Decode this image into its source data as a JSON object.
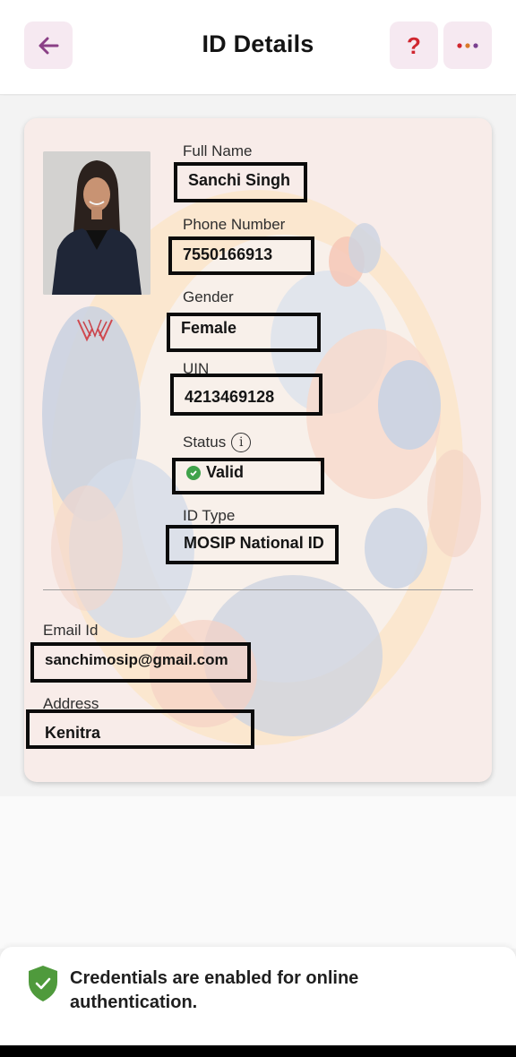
{
  "header": {
    "title": "ID Details",
    "back_icon": "arrow-left-icon",
    "help_label": "?",
    "more_icon": "ellipsis-icon",
    "button_bg": "#f6e9f1",
    "accent": "#8a3f86"
  },
  "card": {
    "photo_icon": "profile-photo",
    "logo_icon": "issuer-logo-icon",
    "fields": {
      "full_name": {
        "label": "Full Name",
        "value": "Sanchi Singh"
      },
      "phone": {
        "label": "Phone Number",
        "value": "7550166913"
      },
      "gender": {
        "label": "Gender",
        "value": "Female"
      },
      "uin": {
        "label": "UIN",
        "value": "4213469128"
      },
      "status": {
        "label": "Status",
        "value": "Valid",
        "status_color": "#3fa24a"
      },
      "id_type": {
        "label": "ID Type",
        "value": "MOSIP National ID"
      },
      "email": {
        "label": "Email Id",
        "value": "sanchimosip@gmail.com"
      },
      "address": {
        "label": "Address",
        "value": "Kenitra"
      }
    }
  },
  "banner": {
    "text": "Credentials are enabled for online authentication.",
    "icon": "shield-check-icon",
    "shield_color": "#4f9a3c"
  }
}
